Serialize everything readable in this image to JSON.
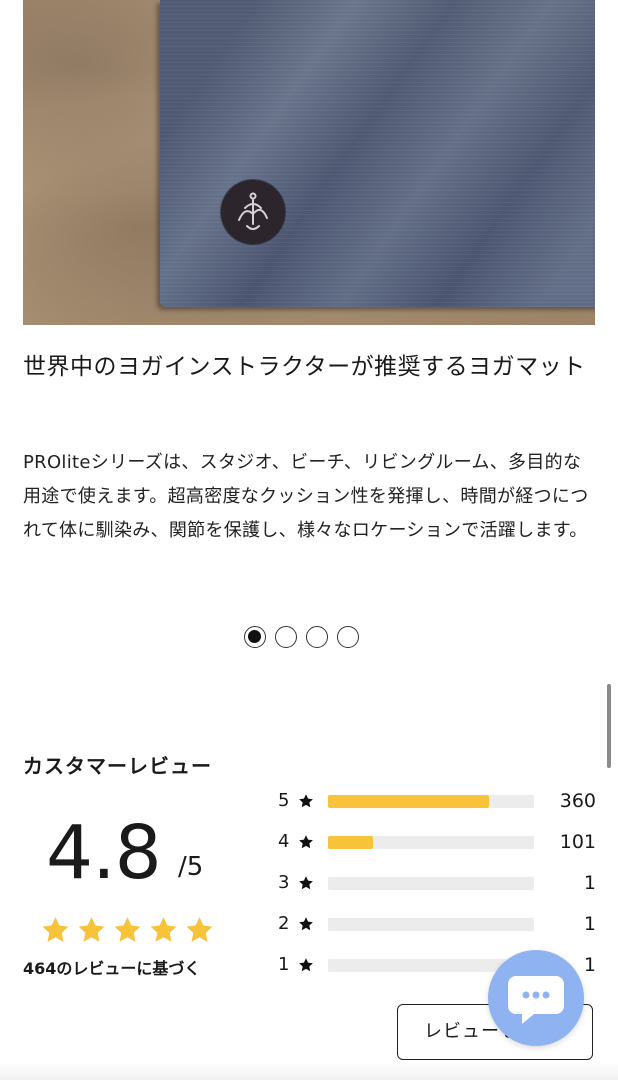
{
  "product": {
    "headline": "世界中のヨガインストラクターが推奨するヨガマット",
    "description": "PROliteシリーズは、スタジオ、ビーチ、リビングルーム、多目的な用途で使えます。超高密度なクッション性を発揮し、時間が経つにつれて体に馴染み、関節を保護し、様々なロケーションで活躍します。"
  },
  "carousel": {
    "total": 4,
    "active": 1
  },
  "reviews": {
    "title": "カスタマーレビュー",
    "average": "4.8",
    "max": "/5",
    "stars": 5,
    "based_on": "464のレビューに基づく",
    "distribution": [
      {
        "star": "5",
        "count": "360",
        "fraction": 0.78
      },
      {
        "star": "4",
        "count": "101",
        "fraction": 0.22
      },
      {
        "star": "3",
        "count": "1",
        "fraction": 0.0
      },
      {
        "star": "2",
        "count": "1",
        "fraction": 0.0
      },
      {
        "star": "1",
        "count": "1",
        "fraction": 0.0
      }
    ],
    "write_button": "レビューを書く"
  },
  "colors": {
    "star_yellow": "#f6c33b",
    "bar_track": "#ececec",
    "chat_bubble": "#8fb3f0"
  },
  "icons": {
    "chat": "chat-bubble-icon",
    "star": "star-icon",
    "logo": "brand-logo-icon"
  }
}
